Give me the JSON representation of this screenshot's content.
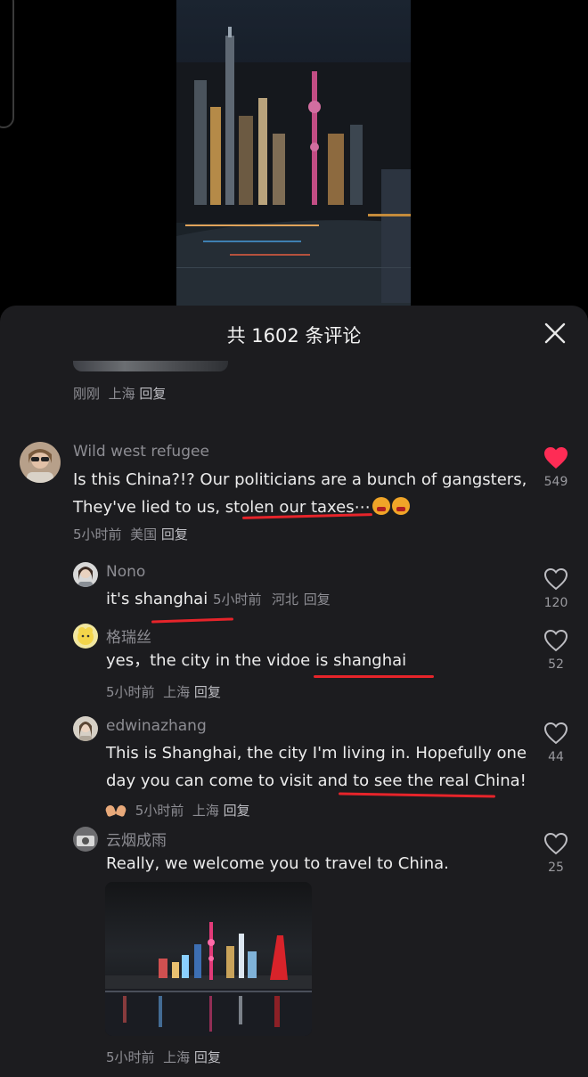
{
  "header": {
    "title": "共 1602 条评论",
    "close_icon": "close-icon"
  },
  "previous_comment": {
    "time": "刚刚",
    "location": "上海",
    "reply": "回复"
  },
  "comments": [
    {
      "username": "Wild west refugee",
      "text_line1": "Is this China?!? Our politicians are a bunch of gangsters,",
      "text_line2": "They've lied to us, stolen our taxes⋯",
      "time": "5小时前",
      "location": "美国",
      "reply": "回复",
      "likes": "549",
      "liked": true
    },
    {
      "username": "Nono",
      "text": "it's shanghai",
      "time": "5小时前",
      "location": "河北",
      "reply": "回复",
      "likes": "120",
      "liked": false
    },
    {
      "username": "格瑞丝",
      "text": "yes，the city in the vidoe is shanghai",
      "time": "5小时前",
      "location": "上海",
      "reply": "回复",
      "likes": "52",
      "liked": false
    },
    {
      "username": "edwinazhang",
      "text_line1": "This is Shanghai, the city I'm living in. Hopefully one",
      "text_line2": "day you can come to visit and to see the real China!",
      "time": "5小时前",
      "location": "上海",
      "reply": "回复",
      "likes": "44",
      "liked": false
    },
    {
      "username": "云烟成雨",
      "text": "Really, we welcome you to travel to China.",
      "time": "5小时前",
      "location": "上海",
      "reply": "回复",
      "likes": "25",
      "liked": false
    }
  ],
  "colors": {
    "sheet_bg": "#1c1c1f",
    "like_red": "#fe2c55",
    "underline_red": "#e6242a"
  }
}
